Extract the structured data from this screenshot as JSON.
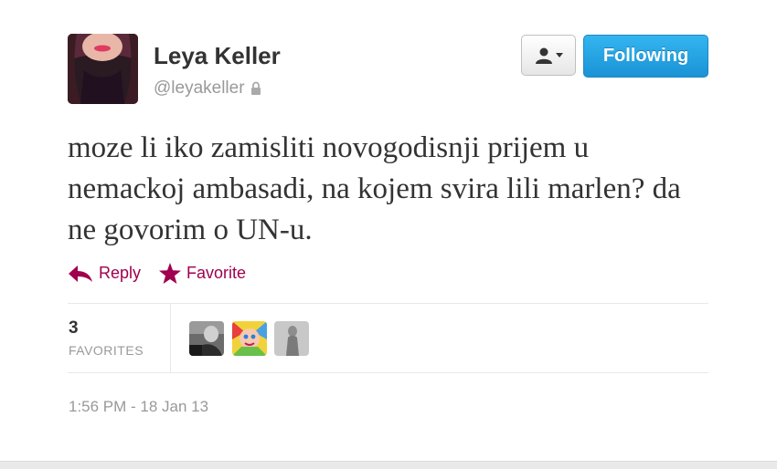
{
  "tweet": {
    "author": {
      "full_name": "Leya Keller",
      "screen_name": "@leyakeller",
      "protected_icon": "lock-icon"
    },
    "buttons": {
      "user_dropdown_icon": "person-icon",
      "follow_label": "Following"
    },
    "text": "moze li iko zamisliti novogodisnji prijem u nemackoj ambasadi, na kojem svira lili marlen? da ne govorim o UN-u.",
    "actions": [
      {
        "label": "Reply",
        "icon": "reply-arrow-icon"
      },
      {
        "label": "Favorite",
        "icon": "star-icon"
      }
    ],
    "stats": {
      "favorites_count": "3",
      "favorites_label": "FAVORITES"
    },
    "timestamp": "1:56 PM - 18 Jan 13",
    "colors": {
      "action": "#a0004e",
      "follow_button": "#1b93d6",
      "muted_text": "#999999"
    }
  }
}
